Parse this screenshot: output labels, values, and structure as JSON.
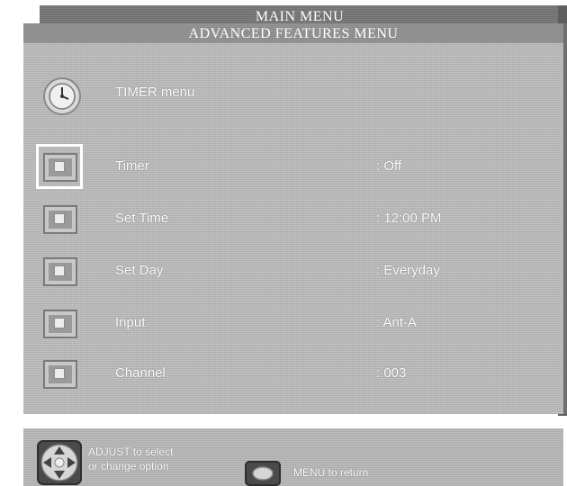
{
  "main_menu": {
    "title": "MAIN MENU"
  },
  "advanced_menu": {
    "title": "ADVANCED FEATURES MENU"
  },
  "submenu": {
    "title": "TIMER menu",
    "icon": "clock-icon"
  },
  "rows": [
    {
      "label": "Timer",
      "value": ":  Off",
      "focused": true
    },
    {
      "label": "Set Time",
      "value": ": 12:00 PM",
      "focused": false
    },
    {
      "label": "Set Day",
      "value": ": Everyday",
      "focused": false
    },
    {
      "label": "Input",
      "value": ": Ant-A",
      "focused": false
    },
    {
      "label": "Channel",
      "value": ": 003",
      "focused": false
    }
  ],
  "help": {
    "adjust_line1": "ADJUST to select",
    "adjust_line2": "or change option",
    "menu": "MENU to return"
  },
  "colors": {
    "panel": "#bcbcbc",
    "header": "#8a8a8a",
    "text": "#ffffff"
  }
}
